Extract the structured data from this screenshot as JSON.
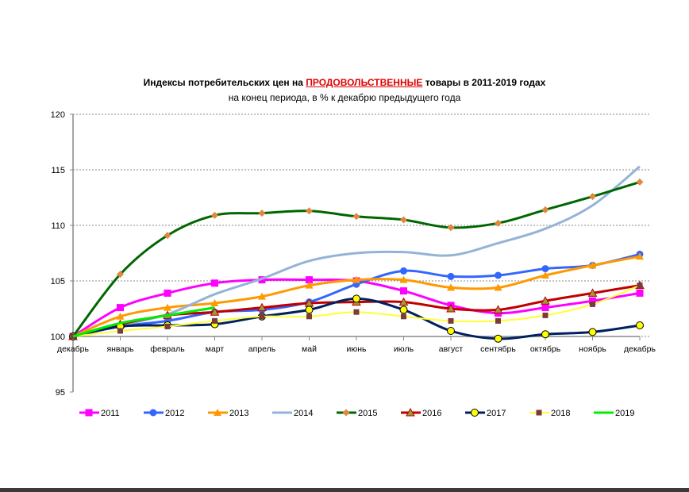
{
  "chart_data": {
    "type": "line",
    "title_prefix": "Индексы потребительских цен на ",
    "title_highlight": "ПРОДОВОЛЬСТВЕННЫЕ",
    "title_suffix": " товары в 2011-2019 годах",
    "subtitle": "на конец периода, в % к декабрю предыдущего года",
    "xlabel": "",
    "ylabel": "",
    "ylim": [
      95,
      120
    ],
    "yticks": [
      "95",
      "100",
      "105",
      "110",
      "115",
      "120"
    ],
    "categories": [
      "декабрь",
      "январь",
      "февраль",
      "март",
      "апрель",
      "май",
      "июнь",
      "июль",
      "август",
      "сентябрь",
      "октябрь",
      "ноябрь",
      "декабрь"
    ],
    "grid": true,
    "legend": "bottom",
    "series": [
      {
        "name": "2011",
        "color": "#ff00ff",
        "marker": "square",
        "values": [
          100,
          102.6,
          103.9,
          104.8,
          105.1,
          105.1,
          105.0,
          104.1,
          102.8,
          102.1,
          102.6,
          103.2,
          103.9
        ]
      },
      {
        "name": "2012",
        "color": "#3366ff",
        "marker": "circle",
        "values": [
          100,
          100.9,
          101.4,
          102.2,
          102.4,
          103.1,
          104.7,
          105.9,
          105.4,
          105.5,
          106.1,
          106.4,
          107.4
        ]
      },
      {
        "name": "2013",
        "color": "#ff9900",
        "marker": "triangle",
        "values": [
          100,
          101.8,
          102.6,
          103.0,
          103.6,
          104.6,
          105.1,
          105.1,
          104.4,
          104.4,
          105.5,
          106.4,
          107.2
        ]
      },
      {
        "name": "2014",
        "color": "#95b3d7",
        "marker": "none",
        "values": [
          100,
          101.0,
          102.0,
          103.8,
          105.2,
          106.8,
          107.5,
          107.6,
          107.3,
          108.4,
          109.7,
          111.8,
          115.3
        ]
      },
      {
        "name": "2015",
        "color": "#006600",
        "marker": "diamond",
        "values": [
          100,
          105.6,
          109.1,
          110.9,
          111.1,
          111.3,
          110.8,
          110.5,
          109.8,
          110.2,
          111.4,
          112.6,
          113.9
        ]
      },
      {
        "name": "2016",
        "color": "#c00000",
        "marker": "triangle2",
        "values": [
          100,
          101.1,
          101.9,
          102.2,
          102.6,
          103.0,
          103.1,
          103.1,
          102.5,
          102.4,
          103.2,
          103.9,
          104.6
        ]
      },
      {
        "name": "2017",
        "color": "#002060",
        "marker": "ycircle",
        "values": [
          100,
          100.9,
          101.0,
          101.1,
          101.8,
          102.4,
          103.4,
          102.4,
          100.5,
          99.8,
          100.2,
          100.4,
          101.0
        ]
      },
      {
        "name": "2018",
        "color": "#ffff33",
        "marker": "bsquare",
        "values": [
          100,
          100.5,
          100.9,
          101.4,
          101.8,
          101.8,
          102.2,
          101.8,
          101.4,
          101.4,
          101.9,
          102.9,
          104.6
        ]
      },
      {
        "name": "2019",
        "color": "#00ee00",
        "marker": "none",
        "values": [
          100,
          101.2,
          101.9,
          102.6
        ]
      }
    ]
  }
}
